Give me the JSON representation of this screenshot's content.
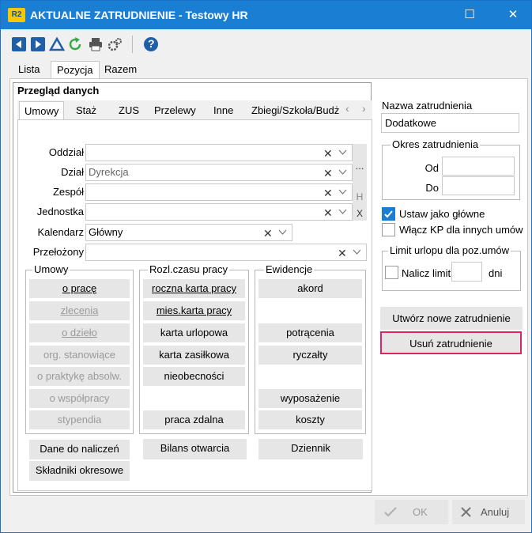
{
  "window": {
    "app_icon": "R2",
    "title": "AKTUALNE ZATRUDNIENIE - Testowy HR",
    "minimize": "☐",
    "close": "✕"
  },
  "toolbar": {
    "icons": [
      "arrow-left-icon",
      "arrow-right-icon",
      "triangle-icon",
      "refresh-icon",
      "print-icon",
      "settings-icon",
      "help-icon"
    ],
    "help_glyph": "?"
  },
  "top_tabs": [
    "Lista",
    "Pozycja",
    "Razem"
  ],
  "section_title": "Przegląd danych",
  "sub_tabs": [
    "Umowy",
    "Staż",
    "ZUS",
    "Przelewy",
    "Inne",
    "Zbiegi/Szkoła/Budż"
  ],
  "tab_arrows": {
    "left": "‹",
    "right": "›"
  },
  "form": {
    "oddzial": {
      "label": "Oddział",
      "value": ""
    },
    "dzial": {
      "label": "Dział",
      "value": "Dyrekcja"
    },
    "zespol": {
      "label": "Zespół",
      "value": ""
    },
    "jednostka": {
      "label": "Jednostka",
      "value": ""
    },
    "kalendarz": {
      "label": "Kalendarz",
      "value": "Główny"
    },
    "przelozony": {
      "label": "Przełożony",
      "value": ""
    },
    "clear_glyph": "✕",
    "side_buttons": {
      "more": "...",
      "h": "H",
      "x": "X"
    }
  },
  "groups": {
    "umowy": {
      "title": "Umowy",
      "items": [
        "o pracę",
        "zlecenia",
        "o dzieło",
        "org. stanowiące",
        "o praktykę absolw.",
        "o współpracy",
        "stypendia"
      ]
    },
    "rozl": {
      "title": "Rozl.czasu pracy",
      "items": [
        "roczna karta pracy",
        "mies.karta pracy",
        "karta urlopowa",
        "karta zasiłkowa",
        "nieobecności",
        "praca zdalna"
      ]
    },
    "ewidencje": {
      "title": "Ewidencje",
      "items": [
        "akord",
        "potrącenia",
        "ryczałty",
        "wyposażenie",
        "koszty"
      ]
    }
  },
  "bottom_buttons": {
    "dane": "Dane do naliczeń",
    "skladniki": "Składniki okresowe",
    "bilans": "Bilans otwarcia",
    "dziennik": "Dziennik"
  },
  "right_panel": {
    "nazwa_label": "Nazwa zatrudnienia",
    "nazwa_value": "Dodatkowe",
    "okres_title": "Okres zatrudnienia",
    "od_label": "Od",
    "od_value": "",
    "do_label": "Do",
    "do_value": "",
    "ustaw_glowne": {
      "label": "Ustaw jako główne",
      "checked": true
    },
    "wlacz_kp": {
      "label": "Włącz KP dla innych umów",
      "checked": false
    },
    "limit_title": "Limit urlopu dla poz.umów",
    "nalicz_limit": {
      "label": "Nalicz limit",
      "checked": false
    },
    "limit_value": "",
    "dni_label": "dni",
    "utworz_btn": "Utwórz nowe zatrudnienie",
    "usun_btn": "Usuń zatrudnienie",
    "usun_border_color": "#e0245e"
  },
  "footer": {
    "ok": "OK",
    "anuluj": "Anuluj"
  },
  "colors": {
    "accent": "#1a7ed3",
    "title_bar": "#1a7ed3"
  }
}
